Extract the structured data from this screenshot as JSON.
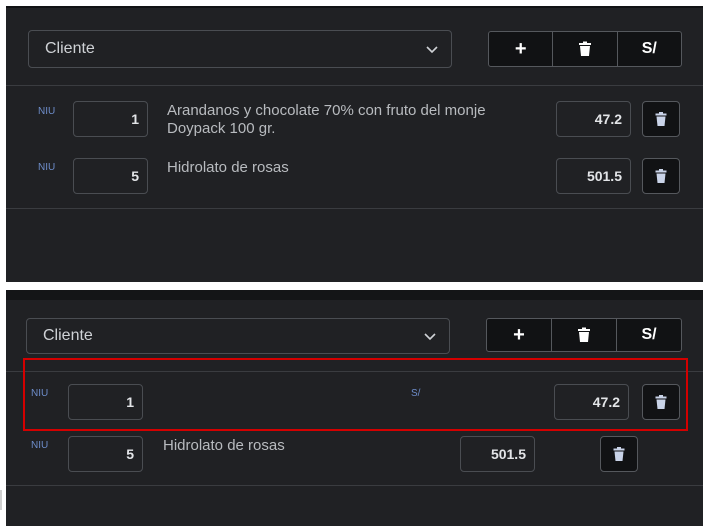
{
  "top_panel": {
    "customer_select": {
      "value": "Cliente"
    },
    "toolbar": {
      "add_label": "+",
      "currency_label": "S/"
    },
    "items": [
      {
        "unit": "NIU",
        "quantity": "1",
        "description_line1": "Arandanos y chocolate 70% con fruto del monje",
        "description_line2": "Doypack 100 gr.",
        "price": "47.2"
      },
      {
        "unit": "NIU",
        "quantity": "5",
        "description_line1": "Hidrolato de rosas",
        "price": "501.5"
      }
    ]
  },
  "bottom_panel": {
    "customer_select": {
      "value": "Cliente"
    },
    "toolbar": {
      "add_label": "+",
      "currency_label": "S/"
    },
    "items": [
      {
        "unit": "NIU",
        "quantity": "1",
        "currency": "S/",
        "price": "47.2"
      },
      {
        "unit": "NIU",
        "quantity": "5",
        "description_line1": "Hidrolato de rosas",
        "price": "501.5"
      }
    ],
    "highlight_color": "#d40000"
  },
  "colors": {
    "background": "#202124",
    "accent_unit": "#6d8cc9",
    "button_dark": "#111214",
    "trash_icon": "#c9d3e8"
  },
  "icons": {
    "dropdown": "chevron-down-icon",
    "delete": "trash-icon",
    "add": "plus-icon"
  }
}
